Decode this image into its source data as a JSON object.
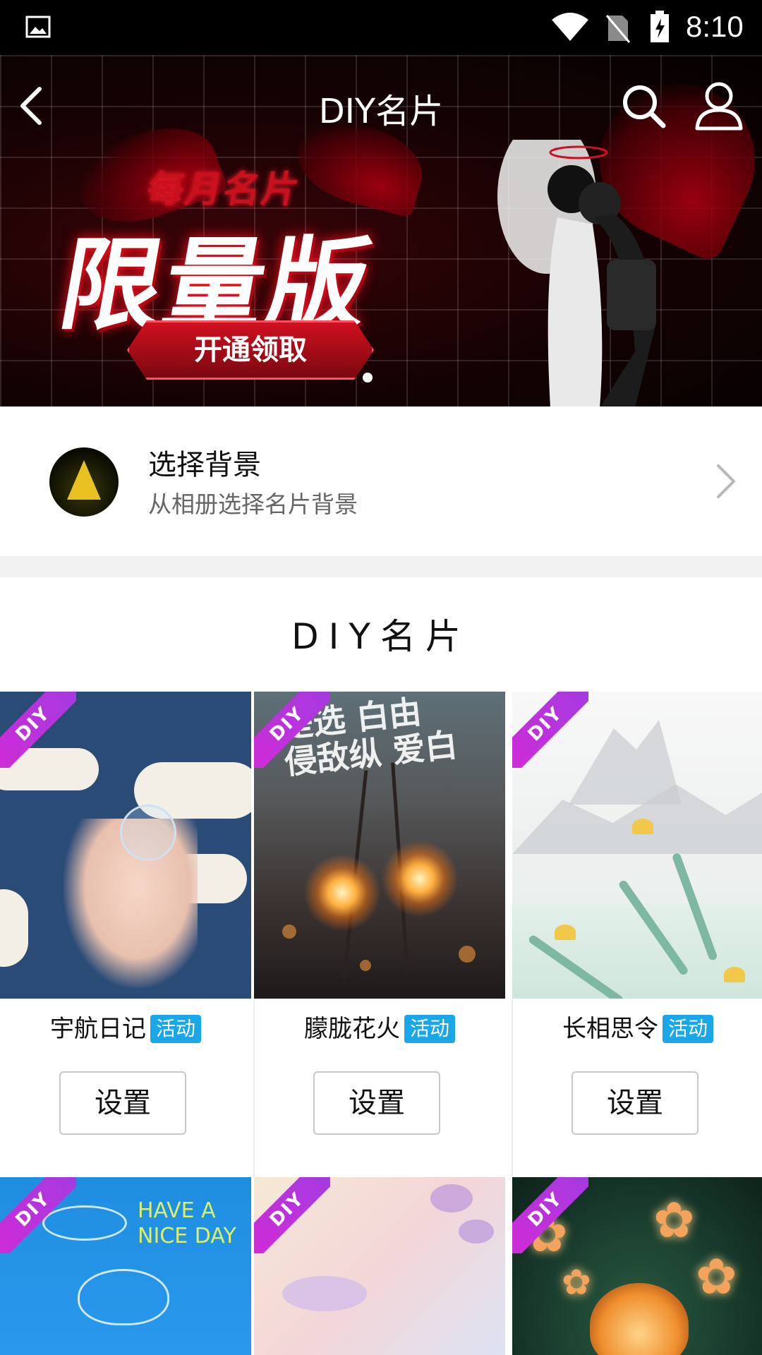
{
  "status_bar": {
    "time": "8:10"
  },
  "top_bar": {
    "title": "DIY名片"
  },
  "banner": {
    "subtitle": "每月名片",
    "headline": "限量版",
    "cta": "开通领取"
  },
  "choose_background": {
    "title": "选择背景",
    "subtitle": "从相册选择名片背景"
  },
  "section": {
    "title": "DIY名片"
  },
  "ribbon_text": "DIY",
  "cards": [
    {
      "name": "宇航日记",
      "badge": "活动",
      "button": "设置"
    },
    {
      "name": "朦胧花火",
      "badge": "活动",
      "button": "设置"
    },
    {
      "name": "长相思令",
      "badge": "活动",
      "button": "设置"
    }
  ],
  "thumb_text": {
    "sparkler_calligraphy": "是选 白由\n侵敌纵 爱白",
    "sky_doodle": "HAVE A\nNICE DAY"
  },
  "colors": {
    "badge": "#1aa7e8",
    "ribbon": "#c02fdc",
    "banner_red": "#c8101e"
  }
}
